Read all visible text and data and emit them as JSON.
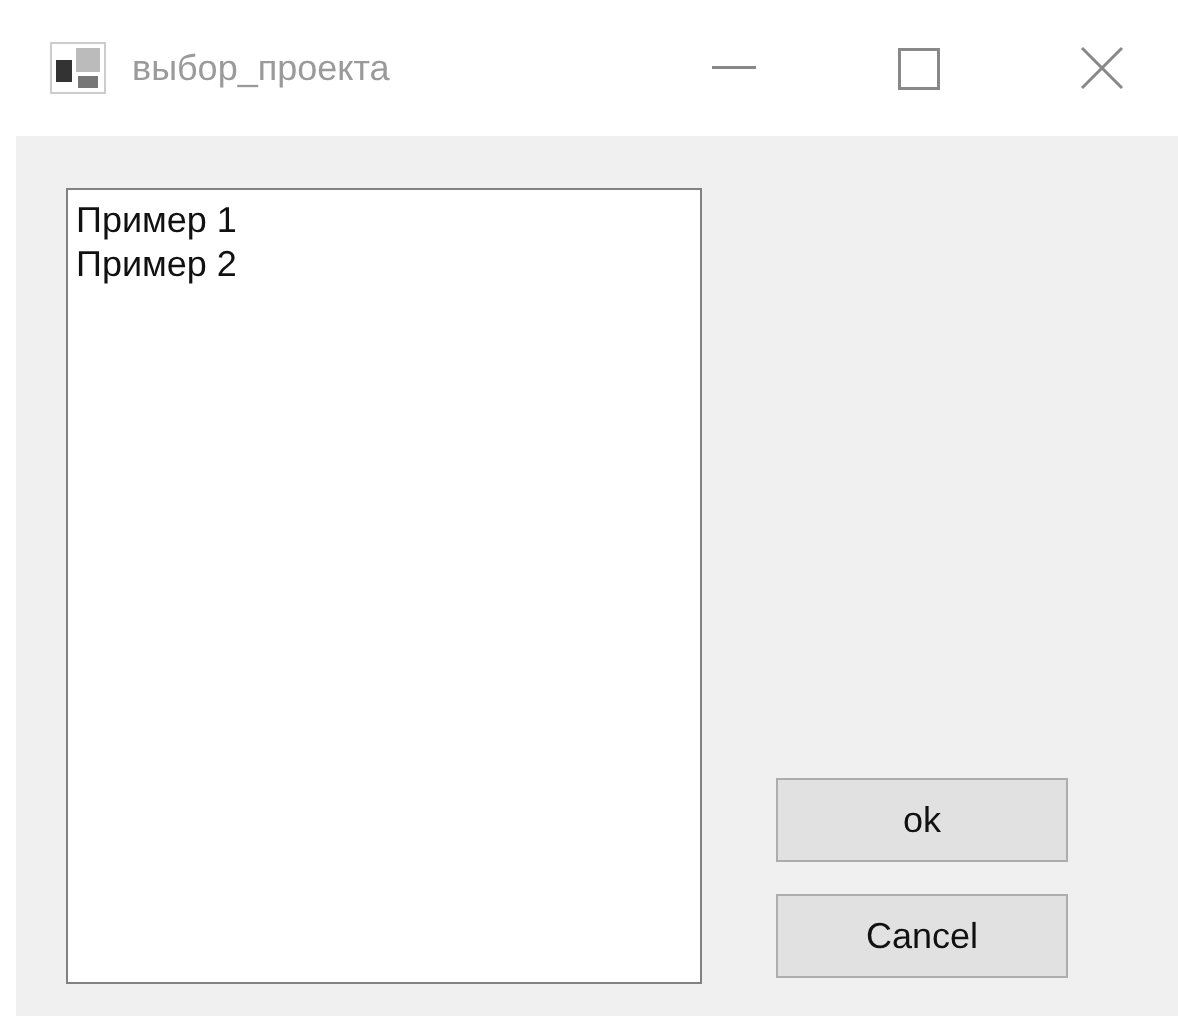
{
  "window": {
    "title": "выбор_проекта"
  },
  "list": {
    "items": [
      {
        "label": "Пример 1",
        "selected": false
      },
      {
        "label": "Пример 2",
        "selected": false
      }
    ]
  },
  "buttons": [
    "ok",
    "Cancel"
  ]
}
